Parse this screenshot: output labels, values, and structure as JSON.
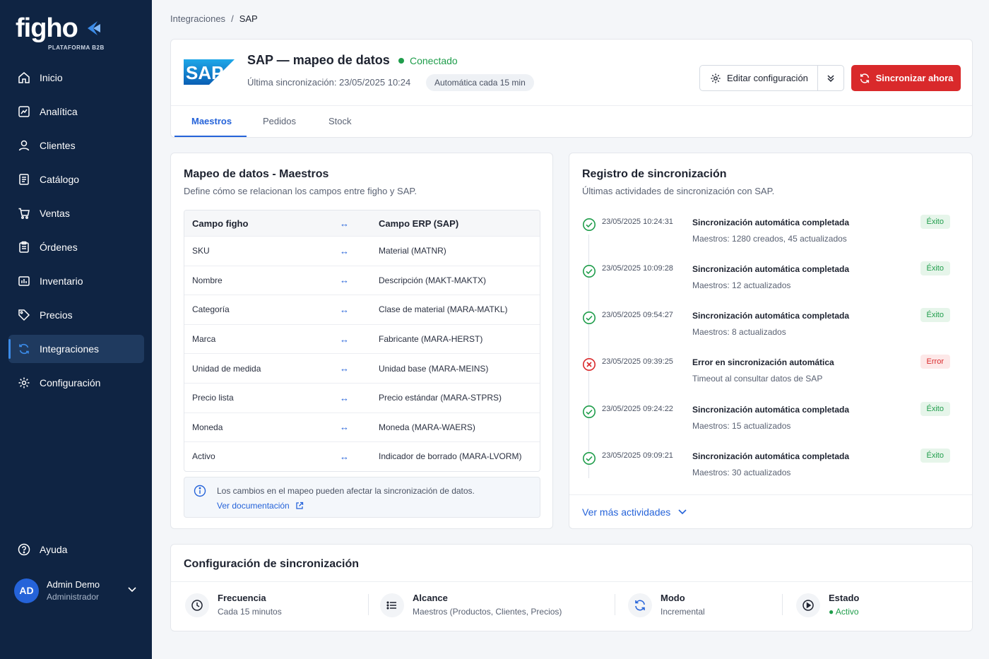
{
  "brand": {
    "logo_text": "figho",
    "logo_subtitle": "PLATAFORMA B2B",
    "accent": "#2563d9",
    "sidebar_bg": "#0f2443",
    "danger": "#d9292b",
    "success": "#1f9d4b"
  },
  "sidebar": {
    "items": [
      {
        "label": "Inicio",
        "icon": "home-icon"
      },
      {
        "label": "Analítica",
        "icon": "chart-icon"
      },
      {
        "label": "Clientes",
        "icon": "user-icon"
      },
      {
        "label": "Catálogo",
        "icon": "book-icon"
      },
      {
        "label": "Ventas",
        "icon": "cart-icon"
      },
      {
        "label": "Órdenes",
        "icon": "clipboard-icon"
      },
      {
        "label": "Inventario",
        "icon": "inventory-icon"
      },
      {
        "label": "Precios",
        "icon": "tag-icon"
      },
      {
        "label": "Integraciones",
        "icon": "integrations-icon",
        "active": true
      },
      {
        "label": "Configuración",
        "icon": "gear-icon"
      }
    ],
    "help_label": "Ayuda",
    "user": {
      "initials": "AD",
      "name": "Admin Demo",
      "role": "Administrador"
    }
  },
  "breadcrumb": {
    "parent": "Integraciones",
    "separator": "/",
    "current": "SAP"
  },
  "header": {
    "sap_logo_text": "SAP",
    "title": "SAP — mapeo de datos",
    "status": "Conectado",
    "last_sync": "Última sincronización: 23/05/2025 10:24",
    "auto_badge": "Automática cada 15 min",
    "edit_button": "Editar configuración",
    "sync_button": "Sincronizar ahora",
    "tabs": [
      {
        "label": "Maestros",
        "active": true
      },
      {
        "label": "Pedidos"
      },
      {
        "label": "Stock"
      }
    ]
  },
  "mapping": {
    "title": "Mapeo de datos - Maestros",
    "subtitle": "Define cómo se relacionan los campos entre figho y SAP.",
    "header": {
      "left": "Campo figho",
      "arrow": "↔",
      "right": "Campo ERP (SAP)"
    },
    "rows": [
      {
        "left": "SKU",
        "arrow": "↔",
        "right": "Material (MATNR)"
      },
      {
        "left": "Nombre",
        "arrow": "↔",
        "right": "Descripción (MAKT-MAKTX)"
      },
      {
        "left": "Categoría",
        "arrow": "↔",
        "right": "Clase de material (MARA-MATKL)"
      },
      {
        "left": "Marca",
        "arrow": "↔",
        "right": "Fabricante (MARA-HERST)"
      },
      {
        "left": "Unidad de medida",
        "arrow": "↔",
        "right": "Unidad base (MARA-MEINS)"
      },
      {
        "left": "Precio lista",
        "arrow": "↔",
        "right": "Precio estándar (MARA-STPRS)"
      },
      {
        "left": "Moneda",
        "arrow": "↔",
        "right": "Moneda (MARA-WAERS)"
      },
      {
        "left": "Activo",
        "arrow": "↔",
        "right": "Indicador de borrado (MARA-LVORM)"
      }
    ],
    "info_text": "Los cambios en el mapeo pueden afectar la sincronización de datos.",
    "info_link": "Ver documentación"
  },
  "log": {
    "title": "Registro de sincronización",
    "subtitle": "Últimas actividades de sincronización con SAP.",
    "items": [
      {
        "time": "23/05/2025 10:24:31",
        "title": "Sincronización automática completada",
        "desc": "Maestros: 1280 creados, 45 actualizados",
        "badge": "Éxito",
        "status": "ok"
      },
      {
        "time": "23/05/2025 10:09:28",
        "title": "Sincronización automática completada",
        "desc": "Maestros: 12 actualizados",
        "badge": "Éxito",
        "status": "ok"
      },
      {
        "time": "23/05/2025 09:54:27",
        "title": "Sincronización automática completada",
        "desc": "Maestros: 8 actualizados",
        "badge": "Éxito",
        "status": "ok"
      },
      {
        "time": "23/05/2025 09:39:25",
        "title": "Error en sincronización automática",
        "desc": "Timeout al consultar datos de SAP",
        "badge": "Error",
        "status": "err"
      },
      {
        "time": "23/05/2025 09:24:22",
        "title": "Sincronización automática completada",
        "desc": "Maestros: 15 actualizados",
        "badge": "Éxito",
        "status": "ok"
      },
      {
        "time": "23/05/2025 09:09:21",
        "title": "Sincronización automática completada",
        "desc": "Maestros: 30 actualizados",
        "badge": "Éxito",
        "status": "ok"
      }
    ],
    "more_link": "Ver más actividades"
  },
  "config": {
    "title": "Configuración de sincronización",
    "items": [
      {
        "label": "Frecuencia",
        "value": "Cada 15 minutos",
        "icon": "clock-icon"
      },
      {
        "label": "Alcance",
        "value": "Maestros (Productos, Clientes, Precios)",
        "icon": "list-icon"
      },
      {
        "label": "Modo",
        "value": "Incremental",
        "icon": "refresh-icon"
      },
      {
        "label": "Estado",
        "value": "● Activo",
        "icon": "play-icon"
      }
    ]
  }
}
